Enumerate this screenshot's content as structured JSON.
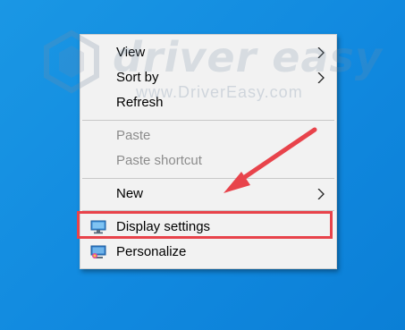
{
  "colors": {
    "desktop": "#1189df",
    "menu_bg": "#f2f2f2",
    "highlight": "#e8434b",
    "disabled_text": "#8c8c8c"
  },
  "watermark": {
    "brand": "driver easy",
    "url": "www.DriverEasy.com"
  },
  "menu": {
    "view": "View",
    "sort_by": "Sort by",
    "refresh": "Refresh",
    "paste": "Paste",
    "paste_shortcut": "Paste shortcut",
    "new": "New",
    "display_settings": "Display settings",
    "personalize": "Personalize"
  },
  "icons": {
    "submenu": "chevron-right-icon",
    "display_settings": "monitor-icon",
    "personalize": "personalize-icon"
  }
}
